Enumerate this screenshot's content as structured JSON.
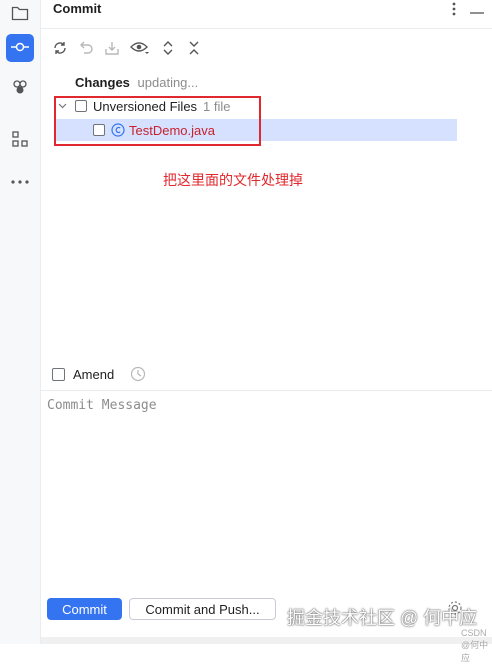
{
  "panel": {
    "title": "Commit",
    "more_icon": "more-vertical-icon",
    "minimize_icon": "minimize-icon"
  },
  "left_rail": {
    "items": [
      {
        "icon": "folder-icon"
      },
      {
        "icon": "commit-icon",
        "active": true
      },
      {
        "icon": "community-icon"
      },
      {
        "icon": "structure-icon"
      },
      {
        "icon": "more-horizontal-icon"
      }
    ]
  },
  "toolbar": {
    "icons": [
      "refresh-icon",
      "rollback-icon",
      "shelve-icon",
      "eye-icon",
      "expand-all-icon",
      "collapse-all-icon"
    ]
  },
  "changes": {
    "label": "Changes",
    "status": "updating..."
  },
  "tree": {
    "group_label": "Unversioned Files",
    "group_count": "1 file",
    "file_name": "TestDemo.java"
  },
  "annotation": {
    "text": "把这里面的文件处理掉"
  },
  "amend": {
    "label": "Amend"
  },
  "commit_message": {
    "placeholder": "Commit Message"
  },
  "buttons": {
    "commit": "Commit",
    "commit_push": "Commit and Push..."
  },
  "watermark": {
    "main": "掘金技术社区 @ 何中应",
    "sub": "CSDN @何中应"
  },
  "colors": {
    "accent": "#3574f0",
    "selection": "#d5e1ff",
    "unversioned_file": "#c7222d",
    "annotation_red": "#e0282e"
  }
}
